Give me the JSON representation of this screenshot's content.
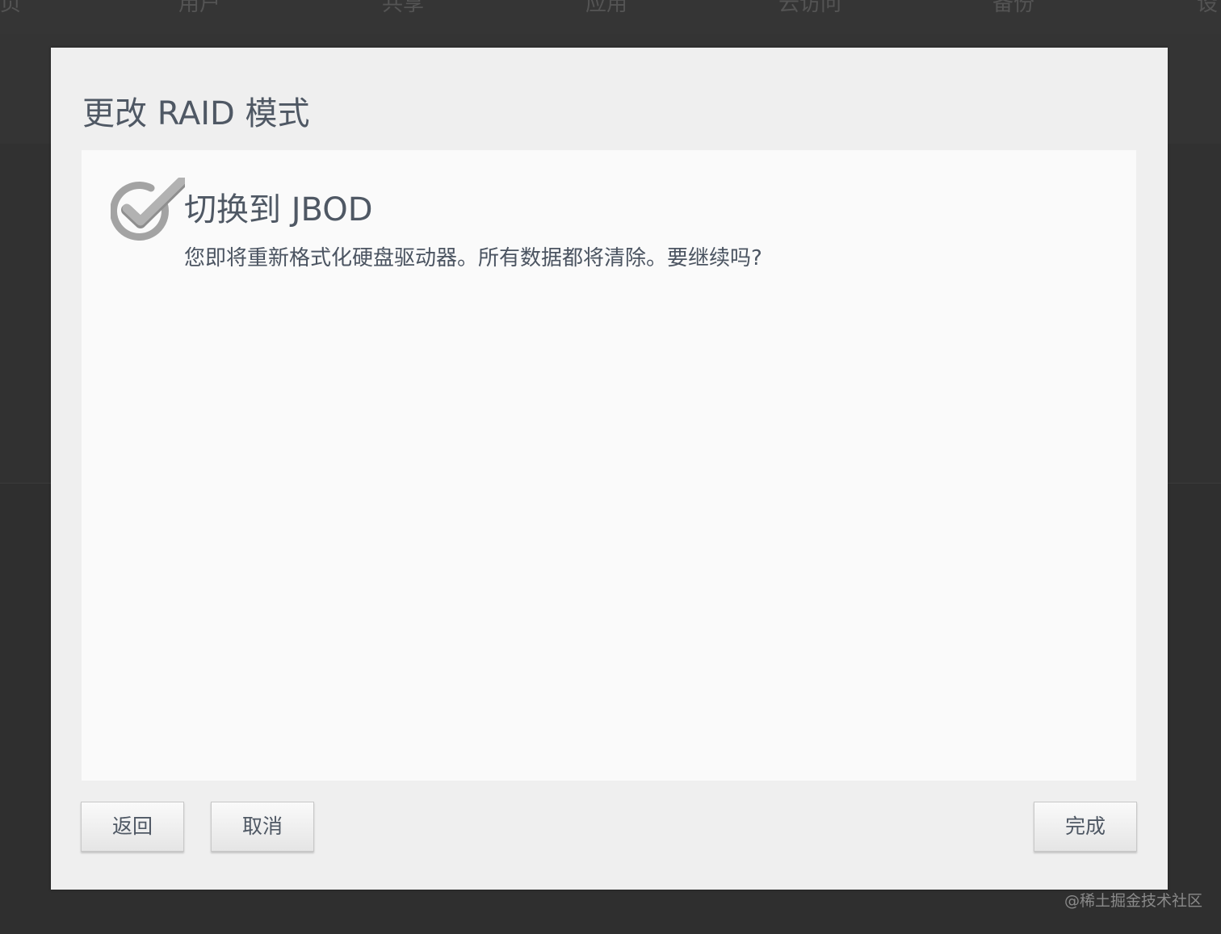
{
  "background_nav": {
    "items": [
      "页",
      "用户",
      "共享",
      "应用",
      "云访问",
      "备份",
      "设"
    ]
  },
  "dialog": {
    "title": "更改 RAID 模式",
    "step_title": "切换到 JBOD",
    "step_description": "您即将重新格式化硬盘驱动器。所有数据都将清除。要继续吗?",
    "buttons": {
      "back": "返回",
      "cancel": "取消",
      "finish": "完成"
    }
  },
  "watermark": "@稀土掘金技术社区",
  "icons": {
    "step_status": "checkmark-circle-icon"
  },
  "colors": {
    "backdrop": "#2f2f2f",
    "dialog_bg": "#efefef",
    "content_bg": "#fafafa",
    "text": "#4f5864",
    "icon_gray": "#a3a3a3"
  }
}
